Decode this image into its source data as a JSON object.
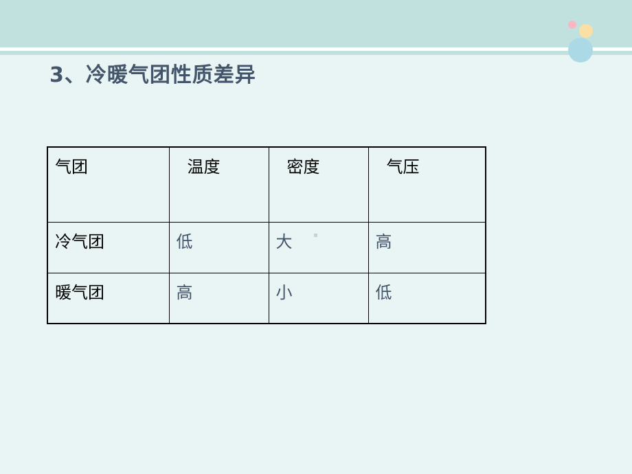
{
  "slide": {
    "title": "3、冷暖气团性质差异"
  },
  "theme": {
    "accent_teal": "#c1e1df",
    "background": "#e9f5f4",
    "title_color": "#44546a",
    "decor_dots": [
      "#f7b8c4",
      "#fbe0a5",
      "#acd9e6"
    ]
  },
  "table": {
    "headers": [
      "气团",
      "温度",
      "密度",
      "气压"
    ],
    "rows": [
      {
        "label": "冷气团",
        "temperature": "低",
        "density": "大",
        "pressure": "高"
      },
      {
        "label": "暖气团",
        "temperature": "高",
        "density": "小",
        "pressure": "低"
      }
    ]
  }
}
